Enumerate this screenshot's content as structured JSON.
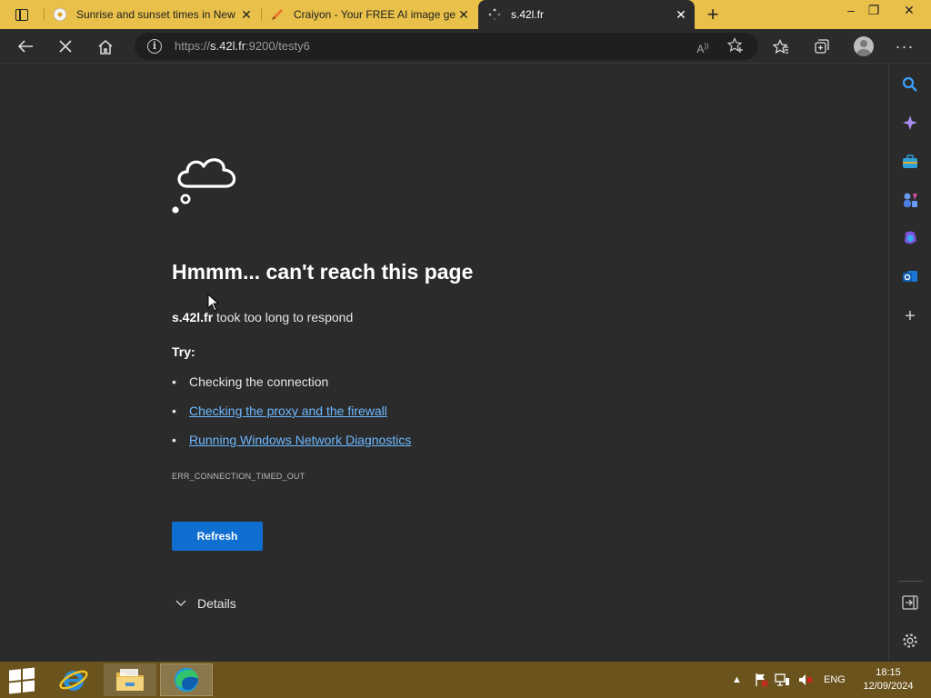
{
  "tabs": [
    {
      "title": "Sunrise and sunset times in New",
      "favicon": "sun-icon",
      "active": false
    },
    {
      "title": "Craiyon - Your FREE AI image ge",
      "favicon": "crayon-icon",
      "active": false
    },
    {
      "title": "s.42l.fr",
      "favicon": "loading-icon",
      "active": true
    }
  ],
  "address": {
    "scheme": "https://",
    "host": "s.42l.fr",
    "rest": ":9200/testy6"
  },
  "error": {
    "heading": "Hmmm... can't reach this page",
    "host": "s.42l.fr",
    "message": " took too long to respond",
    "try_label": "Try:",
    "suggestions": [
      {
        "text": "Checking the connection",
        "link": false
      },
      {
        "text": "Checking the proxy and the firewall",
        "link": true
      },
      {
        "text": "Running Windows Network Diagnostics",
        "link": true
      }
    ],
    "code": "ERR_CONNECTION_TIMED_OUT",
    "refresh_label": "Refresh",
    "details_label": "Details"
  },
  "taskbar": {
    "language": "ENG",
    "time": "18:15",
    "date": "12/09/2024"
  },
  "colors": {
    "titlebar": "#e8c04a",
    "page_bg": "#2b2b2b",
    "link": "#6cb8ff",
    "refresh_button": "#0f6fd1",
    "taskbar": "#6b531d"
  }
}
